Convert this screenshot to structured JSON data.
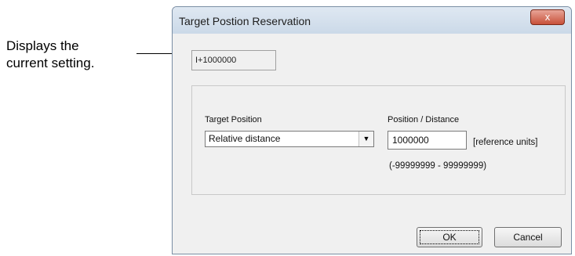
{
  "callout": {
    "line1": "Displays the",
    "line2": "current setting."
  },
  "dialog": {
    "title": "Target Postion Reservation",
    "close_glyph": "x",
    "current_setting": "I+1000000",
    "target_position": {
      "label": "Target Position",
      "selected": "Relative distance"
    },
    "position_distance": {
      "label": "Position / Distance",
      "value": "1000000",
      "unit": "[reference units]",
      "range": "(-99999999 - 99999999)"
    },
    "ok_label": "OK",
    "cancel_label": "Cancel"
  },
  "colors": {
    "close_button": "#c8513a",
    "dialog_bg": "#f0f0f0"
  }
}
